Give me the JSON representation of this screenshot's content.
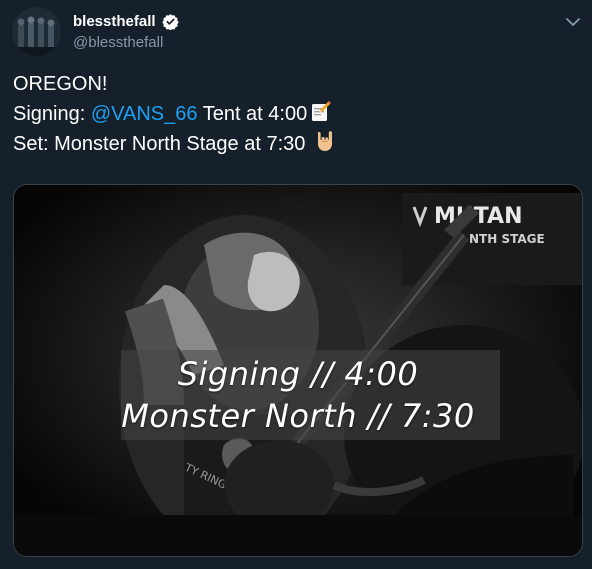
{
  "account": {
    "display_name": "blessthefall",
    "handle": "@blessthefall"
  },
  "tweet": {
    "line1": "OREGON!",
    "line2_prefix": "Signing: ",
    "mention": "@VANS_66",
    "line2_suffix": " Tent at 4:00",
    "line3": "Set: Monster North Stage at 7:30",
    "emoji_memo": "memo-emoji",
    "emoji_rock": "rock-on-hand-emoji"
  },
  "media": {
    "overlay_line1": "Signing // 4:00",
    "overlay_line2": "Monster North // 7:30",
    "banner_text": "MUTAN",
    "banner_subtext": "NTH STAGE",
    "shirt_text": "TY RING"
  },
  "colors": {
    "background": "#15202b",
    "mention": "#1da1f2",
    "secondary_text": "#8899a6",
    "verified": "#1da1f2"
  }
}
